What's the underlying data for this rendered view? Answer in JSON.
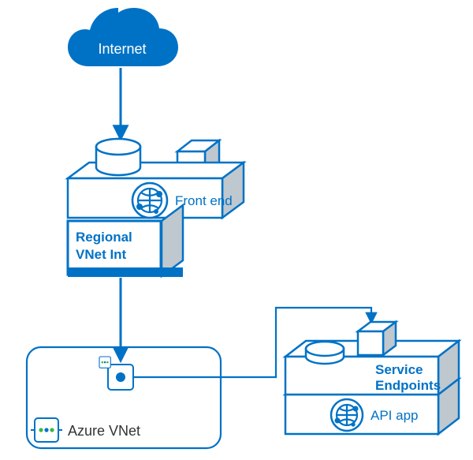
{
  "labels": {
    "internet": "Internet",
    "frontend": "Front end",
    "vnet_int_l1": "Regional",
    "vnet_int_l2": "VNet Int",
    "vnet": "Azure VNet",
    "service_ep_l1": "Service",
    "service_ep_l2": "Endpoints",
    "api_app": "API app"
  },
  "colors": {
    "brand": "#0072c6",
    "shade": "#bfc8ce",
    "bg": "#ffffff"
  }
}
